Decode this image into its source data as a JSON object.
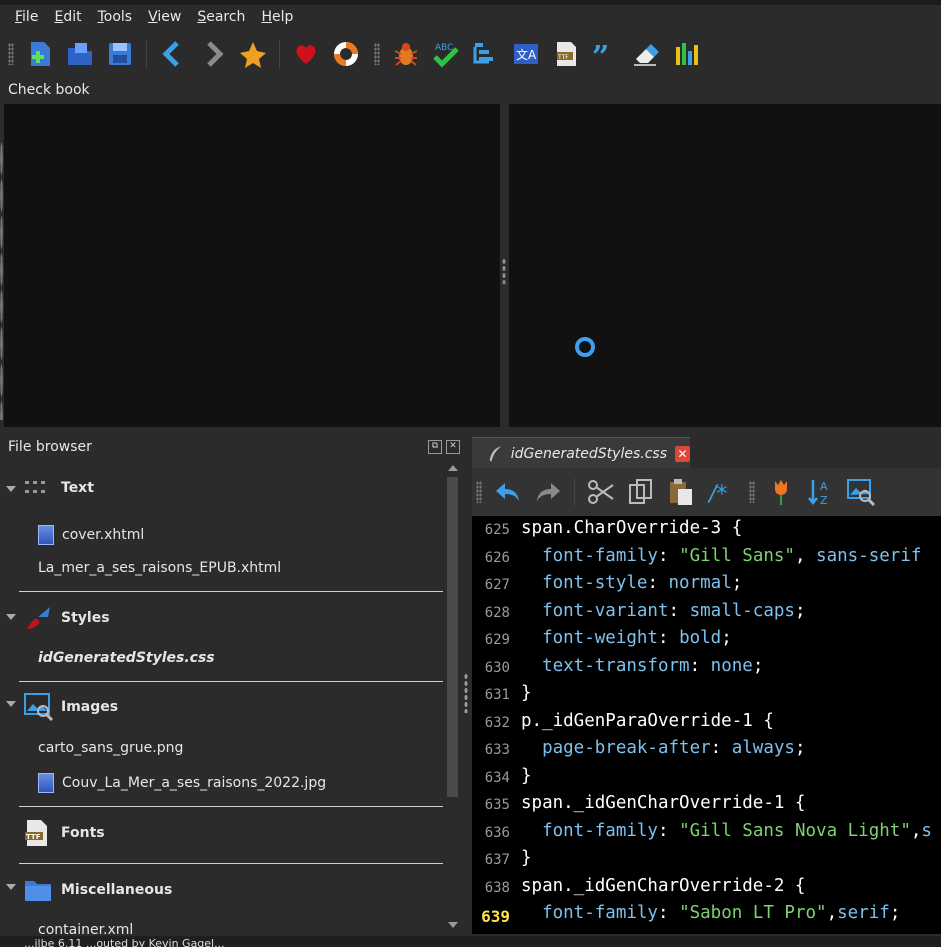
{
  "menu": [
    {
      "label": "File",
      "u": "F",
      "rest": "ile"
    },
    {
      "label": "Edit",
      "u": "E",
      "rest": "dit"
    },
    {
      "label": "Tools",
      "u": "T",
      "rest": "ools"
    },
    {
      "label": "View",
      "u": "V",
      "rest": "iew"
    },
    {
      "label": "Search",
      "u": "S",
      "rest": "earch"
    },
    {
      "label": "Help",
      "u": "H",
      "rest": "elp"
    }
  ],
  "toolbar_icons": [
    "new-file-icon",
    "open-folder-icon",
    "save-icon",
    "back-icon",
    "forward-icon",
    "pin-icon",
    "heart-icon",
    "lifebuoy-icon",
    "bug-icon",
    "spellcheck-icon",
    "toc-icon",
    "translate-icon",
    "font-ttf-icon",
    "quote-icon",
    "eraser-icon",
    "chart-icon"
  ],
  "checkbook": {
    "label": "Check book"
  },
  "file_browser": {
    "title": "File browser",
    "categories": [
      {
        "name": "Text",
        "items": [
          "cover.xhtml",
          "La_mer_a_ses_raisons_EPUB.xhtml"
        ]
      },
      {
        "name": "Styles",
        "items": [
          "idGeneratedStyles.css"
        ]
      },
      {
        "name": "Images",
        "items": [
          "carto_sans_grue.png",
          "Couv_La_Mer_a_ses_raisons_2022.jpg"
        ]
      },
      {
        "name": "Fonts",
        "items": []
      },
      {
        "name": "Miscellaneous",
        "items": [
          "container.xml"
        ]
      }
    ]
  },
  "editor": {
    "tab_label": "idGeneratedStyles.css",
    "lines": [
      {
        "n": "625",
        "text": "span.CharOverride-3 {"
      },
      {
        "n": "626",
        "text": "  font-family: \"Gill Sans\", sans-serif"
      },
      {
        "n": "627",
        "text": "  font-style: normal;"
      },
      {
        "n": "628",
        "text": "  font-variant: small-caps;"
      },
      {
        "n": "629",
        "text": "  font-weight: bold;"
      },
      {
        "n": "630",
        "text": "  text-transform: none;"
      },
      {
        "n": "631",
        "text": "}"
      },
      {
        "n": "632",
        "text": "p._idGenParaOverride-1 {"
      },
      {
        "n": "633",
        "text": "  page-break-after: always;"
      },
      {
        "n": "634",
        "text": "}"
      },
      {
        "n": "635",
        "text": "span._idGenCharOverride-1 {"
      },
      {
        "n": "636",
        "text": "  font-family: \"Gill Sans Nova Light\",s"
      },
      {
        "n": "637",
        "text": "}"
      },
      {
        "n": "638",
        "text": "span._idGenCharOverride-2 {"
      },
      {
        "n": "639",
        "text": "  font-family: \"Sabon LT Pro\",serif;"
      }
    ],
    "current_line": "639"
  },
  "status": "...ilbe 6.11 ...outed by Kevin Gagel..."
}
